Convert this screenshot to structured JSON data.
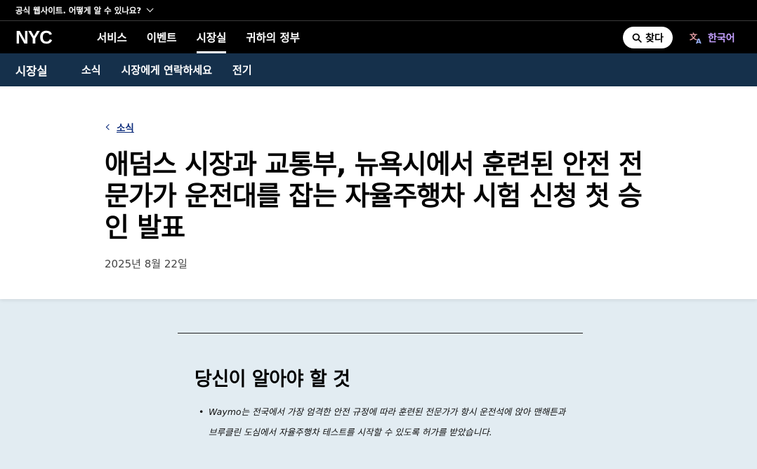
{
  "official_bar": {
    "text": "공식 웹사이트. 어떻게 알 수 있나요?"
  },
  "logo": {
    "text": "NYC"
  },
  "main_nav": {
    "items": [
      {
        "label": "서비스",
        "active": false
      },
      {
        "label": "이벤트",
        "active": false
      },
      {
        "label": "시장실",
        "active": true
      },
      {
        "label": "귀하의 정부",
        "active": false
      }
    ],
    "search_label": "찾다",
    "language_label": "한국어"
  },
  "sub_nav": {
    "title": "시장실",
    "items": [
      "소식",
      "시장에게 연락하세요",
      "전기"
    ]
  },
  "breadcrumb": {
    "label": "소식"
  },
  "article": {
    "title": "애덤스 시장과 교통부, 뉴욕시에서 훈련된 안전 전문가가 운전대를 잡는 자율주행차 시험 신청 첫 승인 발표",
    "date": "2025년 8월 22일"
  },
  "summary": {
    "heading": "당신이 알아야 할 것",
    "bullets": [
      "Waymo는 전국에서 가장 엄격한 안전 규정에 따라 훈련된 전문가가 항시 운전석에 앉아 맨해튼과 브루클린 도심에서 자율주행차 테스트를 시작할 수 있도록 허가를 받았습니다."
    ]
  },
  "colors": {
    "top_bar": "#000000",
    "sub_nav": "#15304b",
    "content_bg": "#e2ecf2",
    "link": "#0a2a7a",
    "language_accent": "#c4a0ff"
  }
}
